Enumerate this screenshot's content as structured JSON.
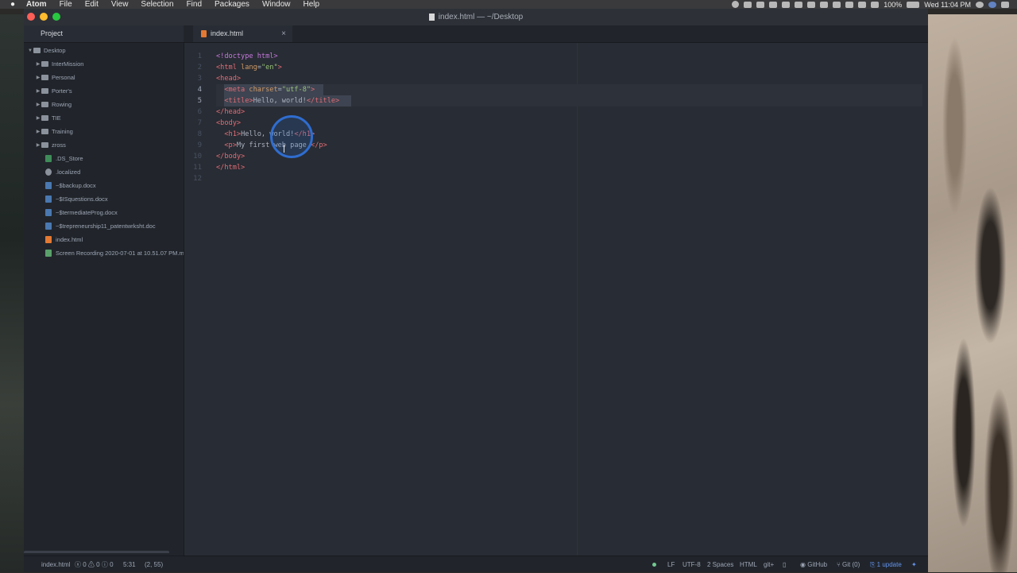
{
  "menubar": {
    "apple_icon": "apple-icon",
    "app_name": "Atom",
    "items": [
      "File",
      "Edit",
      "View",
      "Selection",
      "Find",
      "Packages",
      "Window",
      "Help"
    ],
    "battery": "100%",
    "clock": "Wed 11:04 PM"
  },
  "window": {
    "title": "index.html — ~/Desktop"
  },
  "tabs": {
    "project_label": "Project",
    "file_tab_label": "index.html",
    "close_glyph": "×"
  },
  "tree": {
    "root": "Desktop",
    "folders": [
      "InterMission",
      "Personal",
      "Porter's",
      "Rowing",
      "TIE",
      "Training",
      "zross"
    ],
    "files": [
      ".DS_Store",
      ".localized",
      "~$backup.docx",
      "~$ISquestions.docx",
      "~$termediateProg.docx",
      "~$trepreneurship11_patentwrksht.doc",
      "index.html",
      "Screen Recording 2020-07-01 at 10.51.07 PM.m"
    ]
  },
  "editor": {
    "line_numbers": [
      "1",
      "2",
      "3",
      "4",
      "5",
      "6",
      "7",
      "8",
      "9",
      "10",
      "11",
      "12"
    ],
    "active_lines": [
      4,
      5
    ]
  },
  "code": {
    "l1": [
      "<!doctype html>"
    ],
    "l2": [
      "<html",
      " lang",
      "=",
      "\"en\"",
      ">"
    ],
    "l3": [
      "<head>"
    ],
    "l4": [
      "  ",
      "<meta",
      " charset",
      "=",
      "\"utf-8\"",
      ">"
    ],
    "l5": [
      "  ",
      "<title>",
      "Hello, world!",
      "</title>"
    ],
    "l6": [
      "</head>"
    ],
    "l7": [
      "<body>"
    ],
    "l8": [
      "  ",
      "<h1>",
      "Hello, world!",
      "</h1>"
    ],
    "l9": [
      "  ",
      "<p>",
      "My first web page.",
      "</p>"
    ],
    "l10": [
      "</body>"
    ],
    "l11": [
      "</html>"
    ]
  },
  "statusbar": {
    "file": "index.html",
    "errors": "0",
    "warnings": "0",
    "infos": "0",
    "cursor_pos": "5:31",
    "selection": "(2, 55)",
    "line_ending": "LF",
    "encoding": "UTF-8",
    "indent": "2 Spaces",
    "grammar": "HTML",
    "git_plus": "git+",
    "github": "GitHub",
    "git": "Git (0)",
    "update": "1 update"
  },
  "colors": {
    "editor_bg": "#282c34",
    "tree_bg": "#21252b",
    "tag": "#e06c75",
    "attr": "#d19a66",
    "string": "#98c379",
    "accent": "#6494ed"
  }
}
